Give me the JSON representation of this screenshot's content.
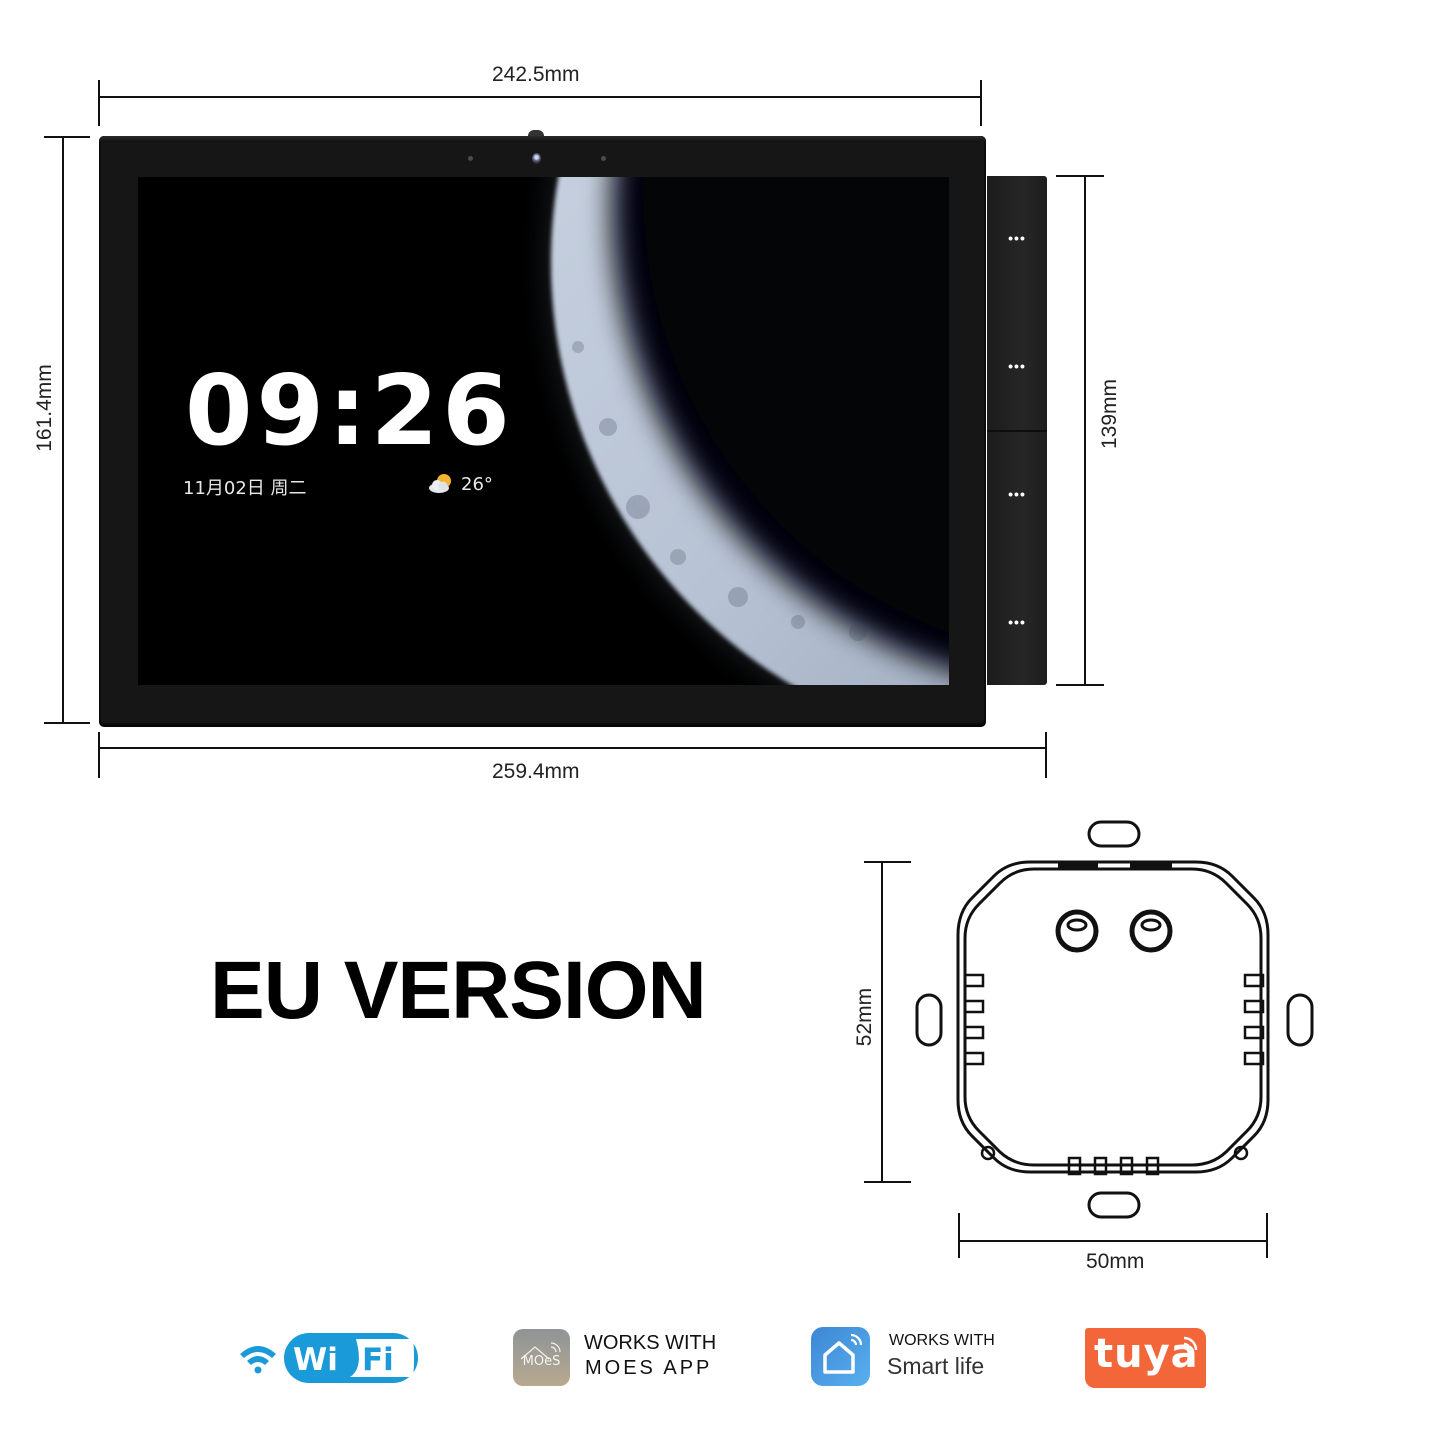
{
  "dimensions": {
    "top_width": "242.5mm",
    "left_height": "161.4mm",
    "right_height": "139mm",
    "bottom_width": "259.4mm",
    "box_height": "52mm",
    "box_width": "50mm"
  },
  "screen": {
    "time": "09:26",
    "date": "11月02日  周二",
    "temperature": "26°",
    "weather_icon": "partly-cloudy-icon",
    "wallpaper": "crescent moon"
  },
  "side_buttons": [
    {
      "label": "•••"
    },
    {
      "label": "•••"
    },
    {
      "label": "•••"
    },
    {
      "label": "•••"
    }
  ],
  "heading": "EU VERSION",
  "logos": {
    "wifi": {
      "left": "Wi",
      "right": "Fi",
      "color": "#1a9ad9"
    },
    "moes": {
      "icon_text": "MOeS",
      "line1": "WORKS WITH",
      "line2": "MOES APP"
    },
    "smart_life": {
      "line1": "WORKS WITH",
      "line2": "Smart life",
      "color": "#3d8ede"
    },
    "tuya": {
      "text": "tuya",
      "color": "#f2663a"
    }
  }
}
